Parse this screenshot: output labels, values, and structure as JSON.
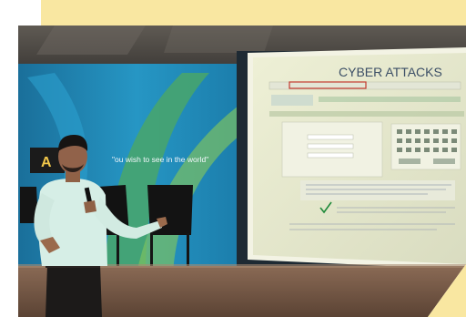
{
  "photo": {
    "slide_title": "CYBER ATTACKS",
    "wall_slogan": "\"ou wish to see in the world\"",
    "sign_letter": "A",
    "colors": {
      "accent_yellow": "#F9E7A1",
      "wall_blue": "#1E8BB8",
      "screen_bg": "#E9EAD2",
      "shirt": "#D7EFE6",
      "floor": "#7A5B47"
    }
  }
}
